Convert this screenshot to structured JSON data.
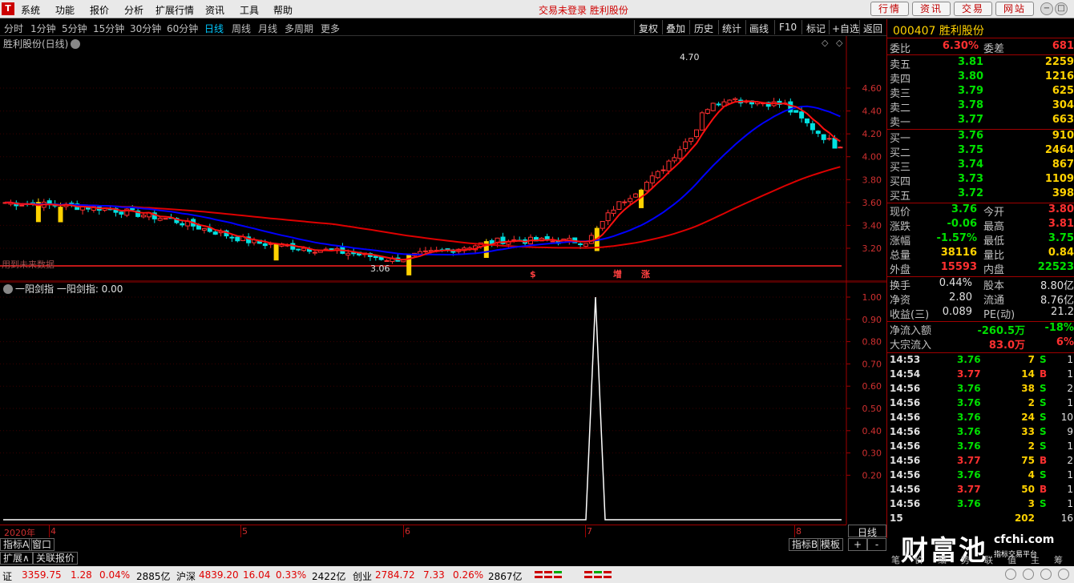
{
  "menubar": {
    "items": [
      "系统",
      "功能",
      "报价",
      "分析",
      "扩展行情",
      "资讯",
      "工具",
      "帮助"
    ],
    "notice": "交易未登录  胜利股份",
    "buttons": [
      "行情",
      "资讯",
      "交易",
      "网站"
    ]
  },
  "periodbar": {
    "periods": [
      "分时",
      "1分钟",
      "5分钟",
      "15分钟",
      "30分钟",
      "60分钟",
      "日线",
      "周线",
      "月线",
      "多周期",
      "更多"
    ],
    "active": "日线",
    "right": [
      "复权",
      "叠加",
      "历史",
      "统计",
      "画线",
      "F10",
      "标记",
      "+自选",
      "返回"
    ]
  },
  "chart": {
    "title": "胜利股份(日线)",
    "future_label": "用到未来数据",
    "signals": [
      "$",
      "增",
      "涨"
    ],
    "high_label": "4.70",
    "low_label": "3.06",
    "y_ticks": [
      "4.60",
      "4.40",
      "4.20",
      "4.00",
      "3.80",
      "3.60",
      "3.40",
      "3.20"
    ],
    "colors": {
      "up": "#ff3030",
      "down": "#00e0e0",
      "ma1": "#ff1010",
      "ma2": "#0000ff",
      "ma3": "#dd0000",
      "yang": "#ffd200"
    }
  },
  "chart_data": {
    "type": "line",
    "title": "一阳剑指  一阳剑指: 0.00",
    "y_ticks": [
      "1.00",
      "0.90",
      "0.80",
      "0.70",
      "0.60",
      "0.50",
      "0.40",
      "0.30",
      "0.20"
    ],
    "ylim": [
      0,
      1.0
    ],
    "series": [
      {
        "name": "一阳剑指",
        "spike_at_date_label": "7",
        "values": [
          0,
          1,
          0
        ]
      }
    ]
  },
  "dateaxis": {
    "labels": [
      "2020年",
      "4",
      "5",
      "6",
      "7",
      "8"
    ],
    "right_label": "日线"
  },
  "tabs": {
    "row1": [
      "指标A",
      "窗口"
    ],
    "row1_right": [
      "指标B",
      "模板",
      "+",
      "-"
    ],
    "row2": [
      "扩展∧",
      "关联报价"
    ]
  },
  "status": {
    "items": [
      {
        "label": "证",
        "value": "3359.75",
        "chg": "1.28",
        "pct": "0.04%",
        "amt": "2885亿"
      },
      {
        "label": "沪深",
        "value": "4839.20",
        "chg": "16.04",
        "pct": "0.33%",
        "amt": "2422亿"
      },
      {
        "label": "创业",
        "value": "2784.72",
        "chg": "7.33",
        "pct": "0.26%",
        "amt": "2867亿"
      }
    ]
  },
  "panel": {
    "code": "000407",
    "name": "胜利股份",
    "weibi": {
      "label": "委比",
      "value": "6.30%",
      "label2": "委差",
      "value2": "681"
    },
    "sell": [
      {
        "label": "卖五",
        "price": "3.81",
        "vol": "2259"
      },
      {
        "label": "卖四",
        "price": "3.80",
        "vol": "1216"
      },
      {
        "label": "卖三",
        "price": "3.79",
        "vol": "625"
      },
      {
        "label": "卖二",
        "price": "3.78",
        "vol": "304"
      },
      {
        "label": "卖一",
        "price": "3.77",
        "vol": "663"
      }
    ],
    "buy": [
      {
        "label": "买一",
        "price": "3.76",
        "vol": "910"
      },
      {
        "label": "买二",
        "price": "3.75",
        "vol": "2464"
      },
      {
        "label": "买三",
        "price": "3.74",
        "vol": "867"
      },
      {
        "label": "买四",
        "price": "3.73",
        "vol": "1109"
      },
      {
        "label": "买五",
        "price": "3.72",
        "vol": "398"
      }
    ],
    "stats": [
      {
        "l": "现价",
        "v": "3.76",
        "vc": "grn",
        "l2": "今开",
        "v2": "3.80",
        "v2c": "red"
      },
      {
        "l": "涨跌",
        "v": "-0.06",
        "vc": "grn",
        "l2": "最高",
        "v2": "3.81",
        "v2c": "red"
      },
      {
        "l": "涨幅",
        "v": "-1.57%",
        "vc": "grn",
        "l2": "最低",
        "v2": "3.75",
        "v2c": "grn"
      },
      {
        "l": "总量",
        "v": "38116",
        "vc": "ylw",
        "l2": "量比",
        "v2": "0.84",
        "v2c": "ylw"
      },
      {
        "l": "外盘",
        "v": "15593",
        "vc": "red",
        "l2": "内盘",
        "v2": "22523",
        "v2c": "grn"
      }
    ],
    "fund": [
      {
        "l": "换手",
        "v": "0.44%",
        "l2": "股本",
        "v2": "8.80亿"
      },
      {
        "l": "净资",
        "v": "2.80",
        "l2": "流通",
        "v2": "8.76亿"
      },
      {
        "l": "收益(三)",
        "v": "0.089",
        "l2": "PE(动)",
        "v2": "21.2"
      }
    ],
    "flow": [
      {
        "l": "净流入额",
        "v": "-260.5万",
        "v2": "-18%",
        "c": "grn"
      },
      {
        "l": "大宗流入",
        "v": "83.0万",
        "v2": "6%",
        "c": "red"
      }
    ],
    "ticks": [
      {
        "t": "14:53",
        "p": "3.76",
        "c": "grn",
        "v": "7",
        "bs": "S",
        "n": "1"
      },
      {
        "t": "14:54",
        "p": "3.77",
        "c": "red",
        "v": "14",
        "bs": "B",
        "n": "1"
      },
      {
        "t": "14:56",
        "p": "3.76",
        "c": "grn",
        "v": "38",
        "bs": "S",
        "n": "2"
      },
      {
        "t": "14:56",
        "p": "3.76",
        "c": "grn",
        "v": "2",
        "bs": "S",
        "n": "1"
      },
      {
        "t": "14:56",
        "p": "3.76",
        "c": "grn",
        "v": "24",
        "bs": "S",
        "n": "10"
      },
      {
        "t": "14:56",
        "p": "3.76",
        "c": "grn",
        "v": "33",
        "bs": "S",
        "n": "9"
      },
      {
        "t": "14:56",
        "p": "3.76",
        "c": "grn",
        "v": "2",
        "bs": "S",
        "n": "1"
      },
      {
        "t": "14:56",
        "p": "3.77",
        "c": "red",
        "v": "75",
        "bs": "B",
        "n": "2"
      },
      {
        "t": "14:56",
        "p": "3.76",
        "c": "grn",
        "v": "4",
        "bs": "S",
        "n": "1"
      },
      {
        "t": "14:56",
        "p": "3.77",
        "c": "red",
        "v": "50",
        "bs": "B",
        "n": "1"
      },
      {
        "t": "14:56",
        "p": "3.76",
        "c": "grn",
        "v": "3",
        "bs": "S",
        "n": "1"
      }
    ],
    "last_tick_partial": {
      "t": "15",
      "v": "202",
      "n": "16"
    }
  },
  "watermark": {
    "big": "财富池",
    "site": "cfchi.com",
    "sub": "指标交易平台"
  },
  "bottom_right_tabs": [
    "笔",
    "价",
    "细",
    "势",
    "联",
    "值",
    "主",
    "筹"
  ]
}
